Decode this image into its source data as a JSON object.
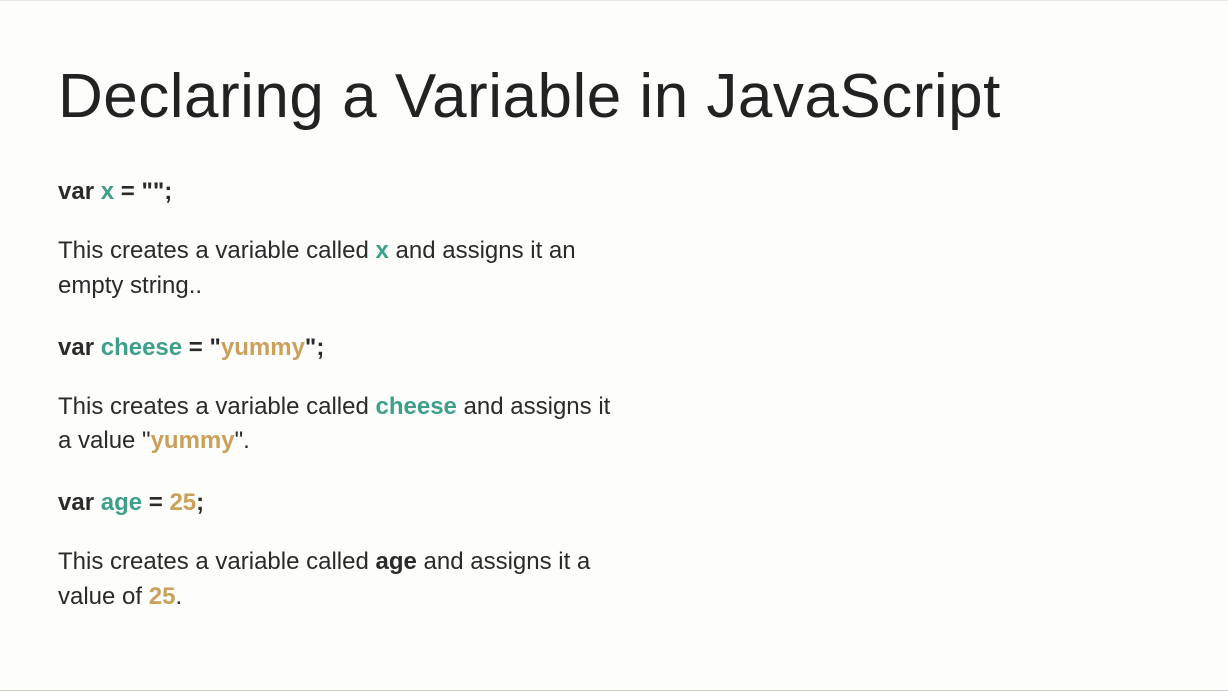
{
  "title": "Declaring a Variable in JavaScript",
  "examples": [
    {
      "code": {
        "keyword": "var",
        "name": "x",
        "op": " = ",
        "value": "\"\"",
        "end": ";"
      },
      "desc": {
        "pre": "This creates a variable called ",
        "highlight": "x",
        "post": " and assigns it an empty string.."
      }
    },
    {
      "code": {
        "keyword": "var",
        "name": "cheese",
        "op": " = ",
        "quote1": "\"",
        "value": "yummy",
        "quote2": "\"",
        "end": ";"
      },
      "desc": {
        "pre": "This creates a variable called ",
        "highlight": "cheese",
        "mid": " and assigns it a value \"",
        "val": "yummy",
        "post": "\"."
      }
    },
    {
      "code": {
        "keyword": "var",
        "name": "age",
        "op": " = ",
        "value": "25",
        "end": ";"
      },
      "desc": {
        "pre": "This creates a variable called ",
        "highlight": "age",
        "mid": " and assigns it a value of ",
        "val": "25",
        "post": "."
      }
    }
  ]
}
